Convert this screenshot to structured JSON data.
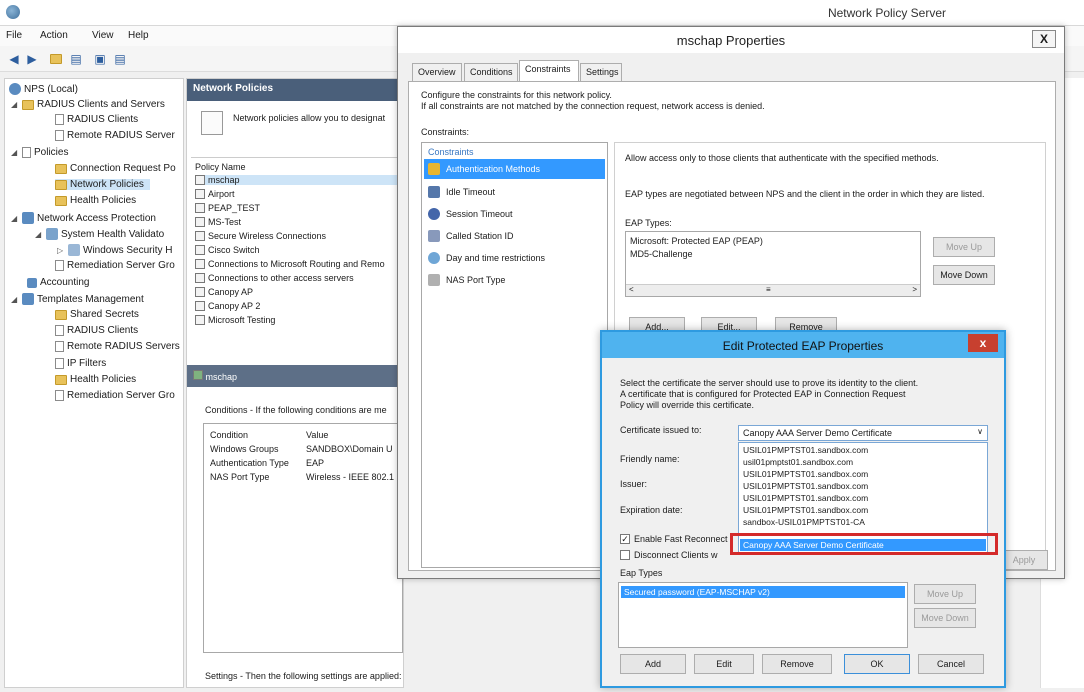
{
  "main_window": {
    "title": "Network Policy Server",
    "menu": [
      "File",
      "Action",
      "View",
      "Help"
    ]
  },
  "tree": {
    "items": [
      {
        "label": "NPS (Local)",
        "level": 0
      },
      {
        "label": "RADIUS Clients and Servers",
        "level": 1
      },
      {
        "label": "RADIUS Clients",
        "level": 2
      },
      {
        "label": "Remote RADIUS Server",
        "level": 2
      },
      {
        "label": "Policies",
        "level": 1
      },
      {
        "label": "Connection Request Po",
        "level": 2
      },
      {
        "label": "Network Policies",
        "level": 2
      },
      {
        "label": "Health Policies",
        "level": 2
      },
      {
        "label": "Network Access Protection",
        "level": 1
      },
      {
        "label": "System Health Validato",
        "level": 2
      },
      {
        "label": "Windows Security H",
        "level": 3
      },
      {
        "label": "Remediation Server Gro",
        "level": 2
      },
      {
        "label": "Accounting",
        "level": 1
      },
      {
        "label": "Templates Management",
        "level": 1
      },
      {
        "label": "Shared Secrets",
        "level": 2
      },
      {
        "label": "RADIUS Clients",
        "level": 2
      },
      {
        "label": "Remote RADIUS Servers",
        "level": 2
      },
      {
        "label": "IP Filters",
        "level": 2
      },
      {
        "label": "Health Policies",
        "level": 2
      },
      {
        "label": "Remediation Server Gro",
        "level": 2
      }
    ]
  },
  "policies_pane": {
    "header": "Network Policies",
    "description": "Network policies allow you to designat",
    "column": "Policy Name",
    "policies": [
      "mschap",
      "Airport",
      "PEAP_TEST",
      "MS-Test",
      "Secure Wireless Connections",
      "Cisco Switch",
      "Connections to Microsoft Routing and Remo",
      "Connections to other access servers",
      "Canopy AP",
      "Canopy AP 2",
      "Microsoft Testing"
    ],
    "detail_header": "mschap",
    "conditions_text": "Conditions - If the following conditions are me",
    "cond_columns": [
      "Condition",
      "Value"
    ],
    "conditions": [
      {
        "condition": "Windows Groups",
        "value": "SANDBOX\\Domain U"
      },
      {
        "condition": "Authentication Type",
        "value": "EAP"
      },
      {
        "condition": "NAS Port Type",
        "value": "Wireless - IEEE 802.1"
      }
    ],
    "settings_text": "Settings - Then the following settings are applied:"
  },
  "mschap_dialog": {
    "title": "mschap Properties",
    "close": "X",
    "tabs": [
      "Overview",
      "Conditions",
      "Constraints",
      "Settings"
    ],
    "intro_line1": "Configure the constraints for this network policy.",
    "intro_line2": "If all constraints are not matched by the connection request, network access is denied.",
    "constraints_label": "Constraints:",
    "constraints_header": "Constraints",
    "constraints": [
      "Authentication Methods",
      "Idle Timeout",
      "Session Timeout",
      "Called Station ID",
      "Day and time restrictions",
      "NAS Port Type"
    ],
    "allow_text": "Allow access only to those clients that authenticate with the specified methods.",
    "eap_info": "EAP types are negotiated between NPS and the client in the order in which they are listed.",
    "eap_types_label": "EAP Types:",
    "eap_types": [
      "Microsoft: Protected EAP (PEAP)",
      "MD5-Challenge"
    ],
    "move_up": "Move Up",
    "move_down": "Move Down",
    "add": "Add...",
    "edit": "Edit...",
    "remove": "Remove",
    "apply": "Apply"
  },
  "eap_dialog": {
    "title": "Edit Protected EAP Properties",
    "close": "x",
    "instr_line1": "Select the certificate the server should use to prove its identity to the client.",
    "instr_line2": "A certificate that is configured for Protected EAP in Connection Request",
    "instr_line3": "Policy will override this certificate.",
    "cert_label": "Certificate issued to:",
    "cert_value": "Canopy AAA Server Demo Certificate",
    "friendly_label": "Friendly name:",
    "issuer_label": "Issuer:",
    "expiration_label": "Expiration date:",
    "cert_options": [
      "USIL01PMPTST01.sandbox.com",
      "usil01pmptst01.sandbox.com",
      "USIL01PMPTST01.sandbox.com",
      "USIL01PMPTST01.sandbox.com",
      "USIL01PMPTST01.sandbox.com",
      "USIL01PMPTST01.sandbox.com",
      "sandbox-USIL01PMPTST01-CA"
    ],
    "cert_selected": "Canopy AAA Server Demo Certificate",
    "fast_reconnect": "Enable Fast Reconnect",
    "disconnect": "Disconnect Clients w",
    "eap_types_label": "Eap Types",
    "eap_type_selected": "Secured password (EAP-MSCHAP v2)",
    "move_up": "Move Up",
    "move_down": "Move Down",
    "add": "Add",
    "edit": "Edit",
    "remove": "Remove",
    "ok": "OK",
    "cancel": "Cancel"
  }
}
